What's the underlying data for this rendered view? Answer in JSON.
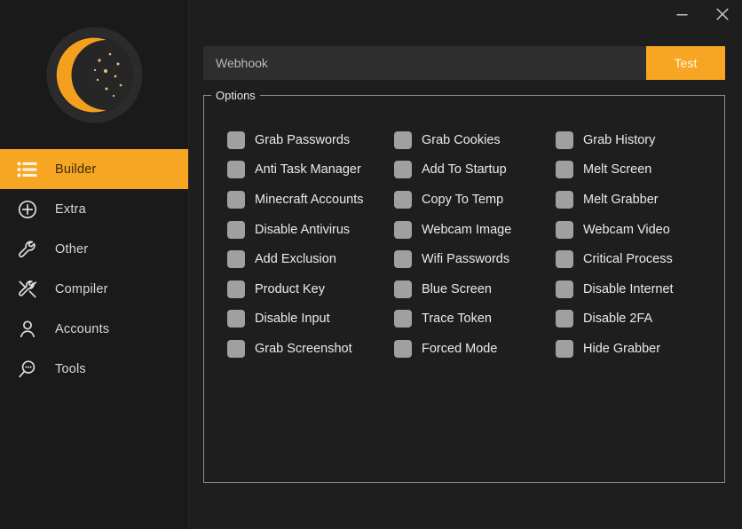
{
  "theme": {
    "accent": "#f6a623",
    "sidebar_bg": "#1a1a1a",
    "content_bg": "#1e1e1e",
    "input_bg": "#2e2e2e",
    "checkbox_fill": "#a0a0a0",
    "text": "#eaeaea"
  },
  "titlebar": {
    "minimize_label": "minimize",
    "close_label": "close"
  },
  "sidebar": {
    "logo_name": "crescent-moon-logo",
    "items": [
      {
        "label": "Builder",
        "icon": "list-icon",
        "active": true
      },
      {
        "label": "Extra",
        "icon": "plus-circle-icon",
        "active": false
      },
      {
        "label": "Other",
        "icon": "wrench-icon",
        "active": false
      },
      {
        "label": "Compiler",
        "icon": "tools-icon",
        "active": false
      },
      {
        "label": "Accounts",
        "icon": "user-icon",
        "active": false
      },
      {
        "label": "Tools",
        "icon": "magnifier-icon",
        "active": false
      }
    ]
  },
  "toolbar": {
    "webhook_value": "",
    "webhook_placeholder": "Webhook",
    "test_label": "Test"
  },
  "options": {
    "legend": "Options",
    "columns": [
      [
        {
          "label": "Grab Passwords",
          "checked": false
        },
        {
          "label": "Anti Task Manager",
          "checked": false
        },
        {
          "label": "Minecraft Accounts",
          "checked": false
        },
        {
          "label": "Disable Antivirus",
          "checked": false
        },
        {
          "label": "Add Exclusion",
          "checked": false
        },
        {
          "label": "Product Key",
          "checked": false
        },
        {
          "label": "Disable Input",
          "checked": false
        },
        {
          "label": "Grab Screenshot",
          "checked": false
        }
      ],
      [
        {
          "label": "Grab Cookies",
          "checked": false
        },
        {
          "label": "Add To Startup",
          "checked": false
        },
        {
          "label": "Copy To Temp",
          "checked": false
        },
        {
          "label": "Webcam Image",
          "checked": false
        },
        {
          "label": "Wifi Passwords",
          "checked": false
        },
        {
          "label": "Blue Screen",
          "checked": false
        },
        {
          "label": "Trace Token",
          "checked": false
        },
        {
          "label": "Forced Mode",
          "checked": false
        }
      ],
      [
        {
          "label": "Grab History",
          "checked": false
        },
        {
          "label": "Melt Screen",
          "checked": false
        },
        {
          "label": "Melt Grabber",
          "checked": false
        },
        {
          "label": "Webcam Video",
          "checked": false
        },
        {
          "label": "Critical Process",
          "checked": false
        },
        {
          "label": "Disable Internet",
          "checked": false
        },
        {
          "label": "Disable 2FA",
          "checked": false
        },
        {
          "label": "Hide Grabber",
          "checked": false
        }
      ]
    ]
  }
}
